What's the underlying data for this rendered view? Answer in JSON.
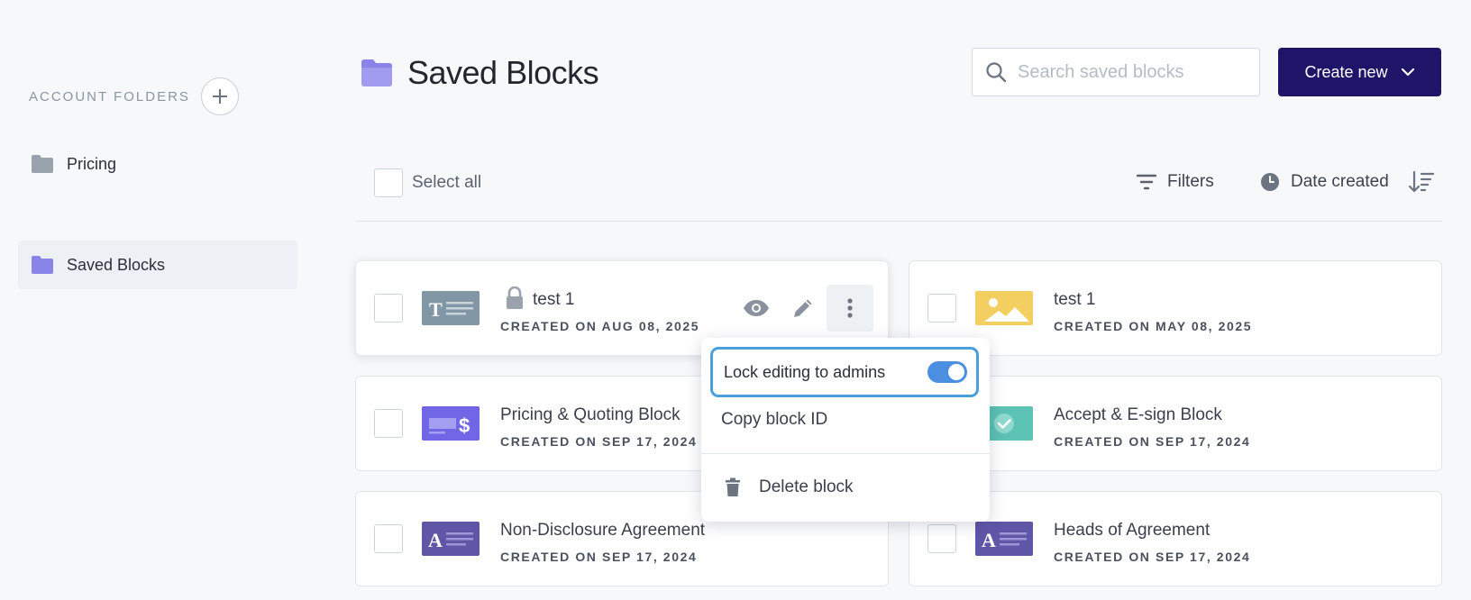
{
  "sidebar": {
    "section_label": "ACCOUNT FOLDERS",
    "items": [
      {
        "label": "Pricing",
        "active": false
      },
      {
        "label": "Saved Blocks",
        "active": true
      }
    ]
  },
  "header": {
    "title": "Saved Blocks",
    "search_placeholder": "Search saved blocks",
    "create_label": "Create new"
  },
  "toolbar": {
    "select_all": "Select all",
    "filters": "Filters",
    "sort_by": "Date created"
  },
  "blocks": [
    {
      "title": "test 1",
      "meta": "CREATED ON AUG 08, 2025",
      "thumb": "text-block",
      "locked": true
    },
    {
      "title": "test 1",
      "meta": "CREATED ON MAY 08, 2025",
      "thumb": "image-block",
      "locked": false
    },
    {
      "title": "Pricing & Quoting Block",
      "meta": "CREATED ON SEP 17, 2024",
      "thumb": "pricing-block",
      "locked": false
    },
    {
      "title": "Accept & E-sign Block",
      "meta": "CREATED ON SEP 17, 2024",
      "thumb": "esign-block",
      "locked": false
    },
    {
      "title": "Non-Disclosure Agreement",
      "meta": "CREATED ON SEP 17, 2024",
      "thumb": "agreement-block",
      "locked": false
    },
    {
      "title": "Heads of Agreement",
      "meta": "CREATED ON SEP 17, 2024",
      "thumb": "agreement-block",
      "locked": false
    }
  ],
  "context_menu": {
    "lock_label": "Lock editing to admins",
    "lock_enabled": true,
    "copy_label": "Copy block ID",
    "delete_label": "Delete block"
  },
  "colors": {
    "primary": "#1e1468",
    "folder_active": "#8b84e8",
    "folder_inactive": "#9aa3ad",
    "toggle_on": "#4a8fe0",
    "focus_ring": "#4a9fdc"
  }
}
